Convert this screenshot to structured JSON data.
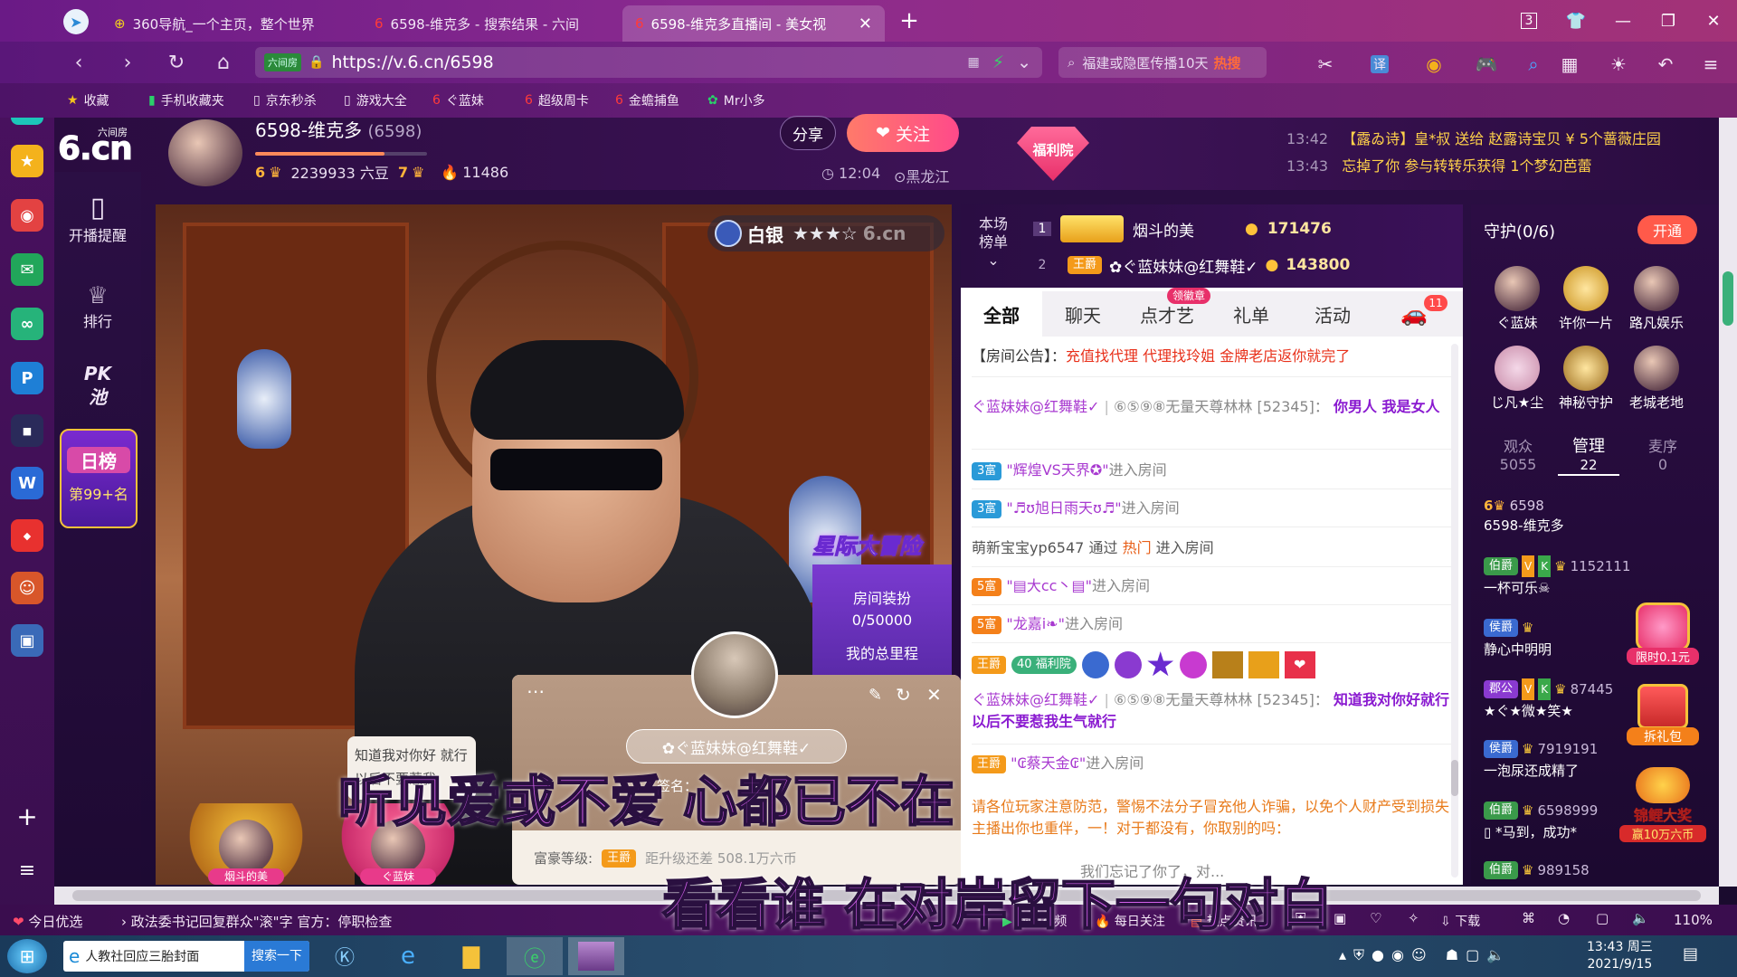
{
  "browser": {
    "tabs": [
      {
        "label": "360导航_一个主页，整个世界"
      },
      {
        "label": "6598-维克多 - 搜索结果 - 六间"
      },
      {
        "label": "6598-维克多直播间 - 美女视"
      }
    ],
    "tab_count": "3",
    "url": "https://v.6.cn/6598",
    "url_badge": "六间房",
    "search_placeholder": "福建或隐匿传播10天",
    "search_hot": "热搜",
    "translate": "译",
    "favorites": [
      {
        "label": "收藏"
      },
      {
        "label": "手机收藏夹"
      },
      {
        "label": "京东秒杀"
      },
      {
        "label": "游戏大全"
      },
      {
        "label": "ぐ蓝妹"
      },
      {
        "label": "超级周卡"
      },
      {
        "label": "金蟾捕鱼"
      },
      {
        "label": "Mr小多"
      }
    ]
  },
  "site": {
    "logo_main": "6.cn",
    "logo_sub": "六间房",
    "nav": [
      {
        "label": "开播提醒"
      },
      {
        "label": "排行"
      },
      {
        "label": "PK池"
      }
    ],
    "daily_rank_title": "日榜",
    "daily_rank_value": "第99+名"
  },
  "host": {
    "name": "6598-维克多",
    "room_id": "(6598)",
    "level": "6",
    "beans": "2239933 六豆",
    "fans_level": "7",
    "fire_count": "11486",
    "time": "12:04",
    "location": "黑龙江",
    "share_label": "分享",
    "follow_label": "关注",
    "welfare_label": "福利院"
  },
  "notices": [
    {
      "time": "13:42",
      "text": "【露ゐ诗】皇*叔 送给 赵露诗宝贝 ¥ 5个蔷薇庄园"
    },
    {
      "time": "13:43",
      "text": "忘掉了你 参与转转乐获得 1个梦幻芭蕾"
    }
  ],
  "video": {
    "silver_badge": "白银",
    "stars": "★★★☆",
    "watermark": "6.cn",
    "event_title": "星际大冒险",
    "room_decor_label": "房间装扮",
    "room_decor_value": "0/50000",
    "total_mileage": "我的总里程",
    "speech_bubble": "知道我对你好 就行 以后不要惹我",
    "fan1": "烟斗的美",
    "fan2": "ぐ蓝妹"
  },
  "lyrics": {
    "line1": "听见爱或不爱 心都已不在",
    "line2": "看看谁 在对岸留下一句对白"
  },
  "profile_card": {
    "name": "✿ぐ蓝妹妹@红舞鞋✓",
    "sign_prefix": "签名：",
    "wealth_label": "富豪等级:",
    "wealth_badge": "王爵",
    "upgrade_text": "距升级还差 508.1万六币"
  },
  "ranking": {
    "title": "本场榜单",
    "rows": [
      {
        "rank": "1",
        "name": "烟斗的美",
        "score": "171476"
      },
      {
        "rank": "2",
        "badge": "王爵",
        "name": "✿ぐ蓝妹妹@红舞鞋✓",
        "score": "143800"
      }
    ]
  },
  "chat": {
    "tabs": [
      {
        "label": "全部"
      },
      {
        "label": "聊天"
      },
      {
        "label": "点才艺"
      },
      {
        "label": "礼单"
      },
      {
        "label": "活动"
      }
    ],
    "tab_badge": "领徽章",
    "car_badge": "11",
    "announcement_label": "【房间公告】：",
    "announcement": "充值找代理 代理找玲姐 金牌老店返你就完了",
    "messages": [
      {
        "user": "ぐ蓝妹妹@红舞鞋✓",
        "sep": "|",
        "to": "⑥⑤⑨⑧无量天尊林林 [52345]：",
        "text": "你男人 我是女人"
      },
      {
        "badge": "3富",
        "user": "\"辉煌VS天界✪\"",
        "text": "进入房间"
      },
      {
        "badge": "3富",
        "user": "\"♬ʊ旭日雨天ʊ♬\"",
        "text": "进入房间"
      },
      {
        "user": "萌新宝宝yp6547",
        "mid": "通过",
        "hot": "热门",
        "text": "进入房间"
      },
      {
        "badge": "5富",
        "user": "\"▤大cc丶▤\"",
        "text": "进入房间"
      },
      {
        "badge": "5富",
        "user": "\"龙嘉i❧\"",
        "text": "进入房间"
      },
      {
        "badge": "王爵",
        "level": "40",
        "welfare": "福利院",
        "user": "ぐ蓝妹妹@红舞鞋✓",
        "to": "⑥⑤⑨⑧无量天尊林林 [52345]：",
        "text": "知道我对你好就行 以后不要惹我生气就行"
      },
      {
        "badge": "王爵",
        "user": "\"₢蔡天金₢\"",
        "text": "进入房间"
      }
    ],
    "warning": "请各位玩家注意防范，警惕不法分子冒充他人诈骗，以免个人财产受到损失",
    "warning2": "主播出你也重伴，一！对于都没有，你取别的吗：",
    "bottom_line": "我们忘记了你了，对..."
  },
  "guard": {
    "title": "守护(0/6)",
    "open_label": "开通",
    "members": [
      {
        "name": "ぐ蓝妹"
      },
      {
        "name": "许你一片"
      },
      {
        "name": "路凡娱乐"
      },
      {
        "name": "じ凡★尘"
      },
      {
        "name": "神秘守护"
      },
      {
        "name": "老城老地"
      }
    ],
    "stats": [
      {
        "label": "观众",
        "value": "5055"
      },
      {
        "label": "管理",
        "value": "22"
      },
      {
        "label": "麦序",
        "value": "0"
      }
    ],
    "viewers": [
      {
        "level": "6",
        "id": "6598",
        "name": "6598-维克多"
      },
      {
        "badge": "伯爵",
        "score": "1152111",
        "name": "一杯可乐☠"
      },
      {
        "badge": "侯爵",
        "name": "静心中明明"
      },
      {
        "badge": "郡公",
        "score": "87445",
        "name": "★ぐ★微★笑★"
      },
      {
        "badge": "侯爵",
        "score": "7919191",
        "name": "一泡尿还成精了"
      },
      {
        "badge": "伯爵",
        "score": "6598999",
        "name": "*马到，成功*"
      },
      {
        "badge": "伯爵",
        "score": "989158",
        "name": ""
      }
    ],
    "promo1": "限时0.1元",
    "promo2": "拆礼包",
    "promo3": "锦鲤大奖",
    "promo4": "赢10万六币"
  },
  "statusbar": {
    "news1": "今日优选",
    "news2": "政法委书记回复群众\"滚\"字 官方：停职检查",
    "items": [
      {
        "label": "我的视频"
      },
      {
        "label": "每日关注"
      },
      {
        "label": "热点资讯"
      },
      {
        "label": "下载"
      }
    ],
    "zoom": "110%"
  },
  "taskbar": {
    "search_text": "人教社回应三胎封面",
    "search_btn": "搜索一下",
    "time": "13:43 周三",
    "date": "2021/9/15"
  }
}
